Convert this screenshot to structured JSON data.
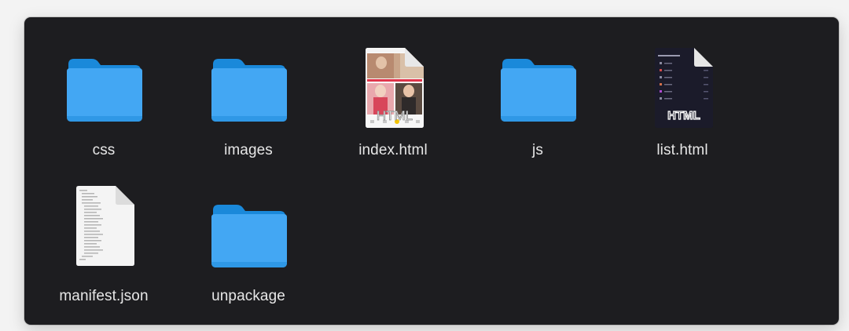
{
  "items": [
    {
      "label": "css",
      "icon": "folder-icon",
      "kind": "folder"
    },
    {
      "label": "images",
      "icon": "folder-icon",
      "kind": "folder"
    },
    {
      "label": "index.html",
      "icon": "html-file-icon",
      "kind": "file",
      "badge": "HTML"
    },
    {
      "label": "js",
      "icon": "folder-icon",
      "kind": "folder"
    },
    {
      "label": "list.html",
      "icon": "html-file-icon",
      "kind": "file",
      "badge": "HTML"
    },
    {
      "label": "manifest.json",
      "icon": "json-file-icon",
      "kind": "file"
    },
    {
      "label": "unpackage",
      "icon": "folder-icon",
      "kind": "folder"
    }
  ],
  "colors": {
    "window_bg": "#1d1d20",
    "folder_front": "#43a7f3",
    "folder_tab": "#1a89da",
    "label": "#e7e7e7"
  }
}
